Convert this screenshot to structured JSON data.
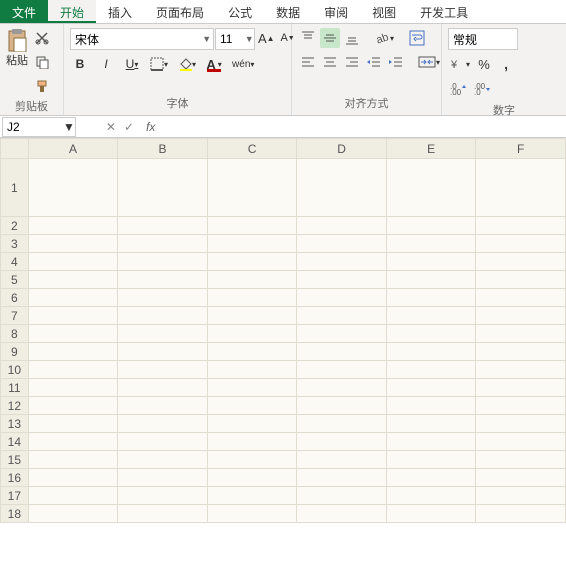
{
  "tabs": {
    "file": "文件",
    "home": "开始",
    "insert": "插入",
    "layout": "页面布局",
    "formula": "公式",
    "data": "数据",
    "review": "审阅",
    "view": "视图",
    "dev": "开发工具"
  },
  "clipboard": {
    "paste": "粘贴",
    "label": "剪贴板"
  },
  "font": {
    "name": "宋体",
    "size": "11",
    "bold": "B",
    "italic": "I",
    "underline": "U",
    "label": "字体",
    "wen": "wén"
  },
  "align": {
    "label": "对齐方式"
  },
  "number": {
    "format": "常规",
    "percent": "%",
    "label": "数字"
  },
  "namebox": {
    "cell": "J2"
  },
  "cols": [
    "A",
    "B",
    "C",
    "D",
    "E",
    "F"
  ],
  "rows": [
    "1",
    "2",
    "3",
    "4",
    "5",
    "6",
    "7",
    "8",
    "9",
    "10",
    "11",
    "12",
    "13",
    "14",
    "15",
    "16",
    "17",
    "18"
  ]
}
